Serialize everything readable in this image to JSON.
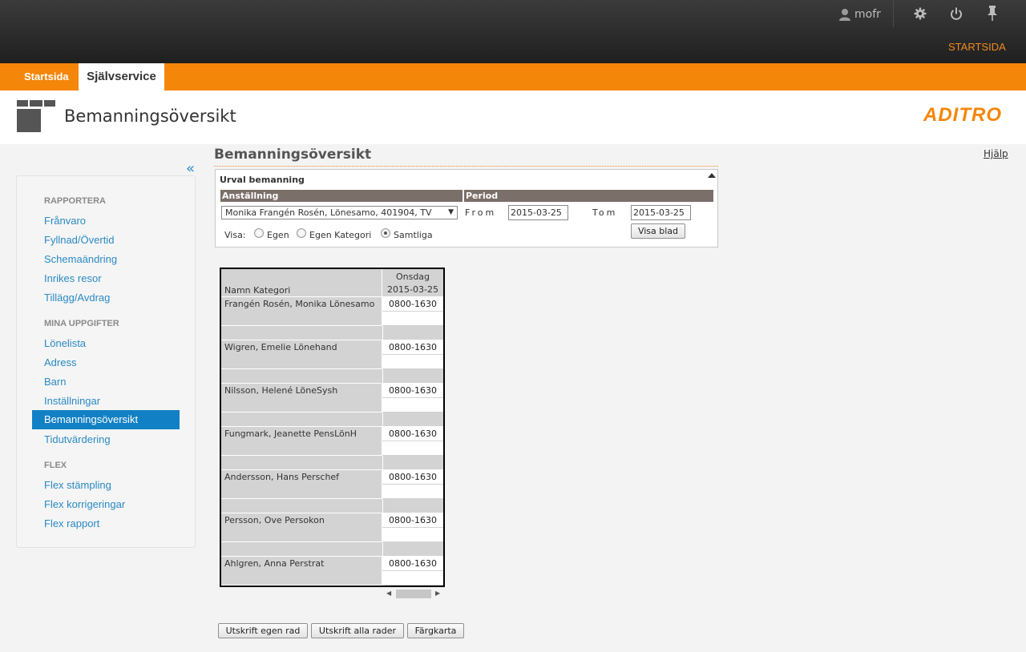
{
  "topbar": {
    "username": "mofr",
    "startsida_link": "STARTSIDA",
    "icons": [
      "user-icon",
      "gear-icon",
      "power-icon",
      "pin-icon"
    ]
  },
  "nav": {
    "tab_start": "Startsida",
    "tab_self": "Självservice"
  },
  "header": {
    "title": "Bemanningsöversikt",
    "brand": "ADITRO"
  },
  "sidebar": {
    "collapse_glyph": "«",
    "sections": [
      {
        "title": "RAPPORTERA",
        "items": [
          "Frånvaro",
          "Fyllnad/Övertid",
          "Schemaändring",
          "Inrikes resor",
          "Tillägg/Avdrag"
        ]
      },
      {
        "title": "MINA UPPGIFTER",
        "items": [
          "Lönelista",
          "Adress",
          "Barn",
          "Inställningar",
          "Bemanningsöversikt",
          "Tidutvärdering"
        ]
      },
      {
        "title": "FLEX",
        "items": [
          "Flex stämpling",
          "Flex korrigeringar",
          "Flex rapport"
        ]
      }
    ],
    "active_item": "Bemanningsöversikt"
  },
  "main": {
    "title": "Bemanningsöversikt",
    "help": "Hjälp",
    "urval": {
      "title": "Urval bemanning",
      "col_anstallning": "Anställning",
      "col_period": "Period",
      "employee": "Monika Frangén Rosén, Lönesamo, 401904, TV",
      "from_label": "From",
      "from_value": "2015-03-25",
      "tom_label": "Tom",
      "tom_value": "2015-03-25",
      "visa_blad": "Visa blad",
      "visa_label": "Visa:",
      "visa_options": [
        "Egen",
        "Egen Kategori",
        "Samtliga"
      ],
      "visa_selected": "Samtliga"
    },
    "grid": {
      "col_name": "Namn Kategori",
      "day": "Onsdag",
      "date": "2015-03-25",
      "rows": [
        {
          "name": "Frangén Rosén, Monika Lönesamo",
          "time": "0800-1630"
        },
        {
          "name": "Wigren, Emelie Lönehand",
          "time": "0800-1630"
        },
        {
          "name": "Nilsson, Helené LöneSysh",
          "time": "0800-1630"
        },
        {
          "name": "Fungmark, Jeanette PensLönH",
          "time": "0800-1630"
        },
        {
          "name": "Andersson, Hans Perschef",
          "time": "0800-1630"
        },
        {
          "name": "Persson, Ove Persokon",
          "time": "0800-1630"
        },
        {
          "name": "Ahlgren, Anna Perstrat",
          "time": "0800-1630"
        }
      ]
    },
    "buttons": {
      "print_own": "Utskrift egen rad",
      "print_all": "Utskrift alla rader",
      "color_map": "Färgkarta"
    }
  }
}
